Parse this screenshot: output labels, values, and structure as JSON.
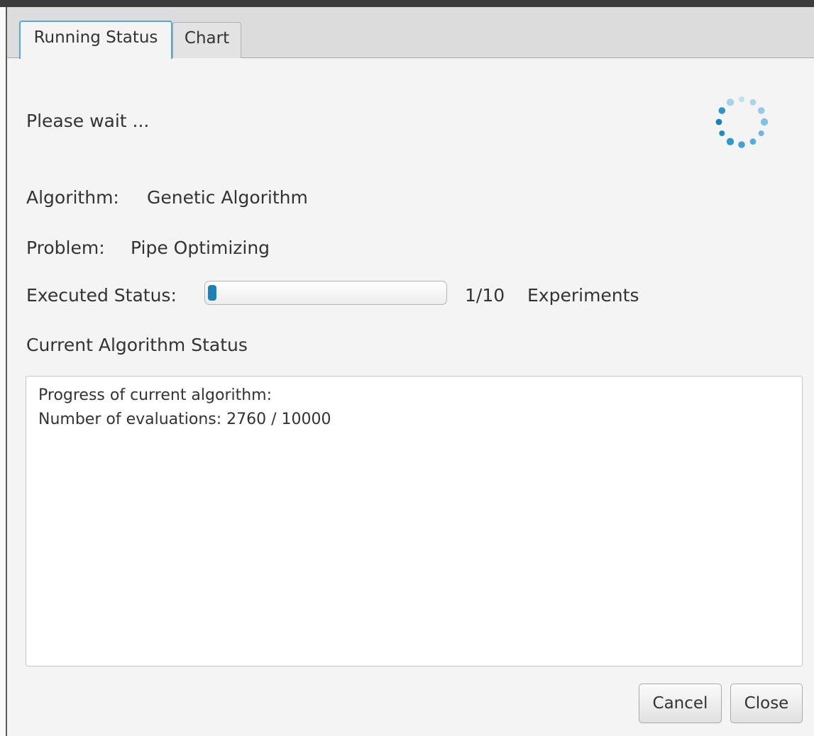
{
  "tabs": [
    {
      "label": "Running Status"
    },
    {
      "label": "Chart"
    }
  ],
  "wait_text": "Please wait ...",
  "algorithm": {
    "label": "Algorithm:",
    "value": "Genetic Algorithm"
  },
  "problem": {
    "label": "Problem:",
    "value": "Pipe Optimizing"
  },
  "executed": {
    "label": "Executed Status:",
    "progress_fraction": 0.1,
    "count_text": "1/10",
    "unit_text": "Experiments"
  },
  "current_status_heading": "Current Algorithm Status",
  "status_lines": [
    "Progress of current algorithm:",
    "Number of evaluations: 2760 / 10000"
  ],
  "buttons": {
    "cancel": "Cancel",
    "close": "Close"
  },
  "colors": {
    "accent": "#1b82b7",
    "tab_focus": "#57a8d8"
  },
  "icons": {
    "spinner": "loading-spinner-icon"
  }
}
